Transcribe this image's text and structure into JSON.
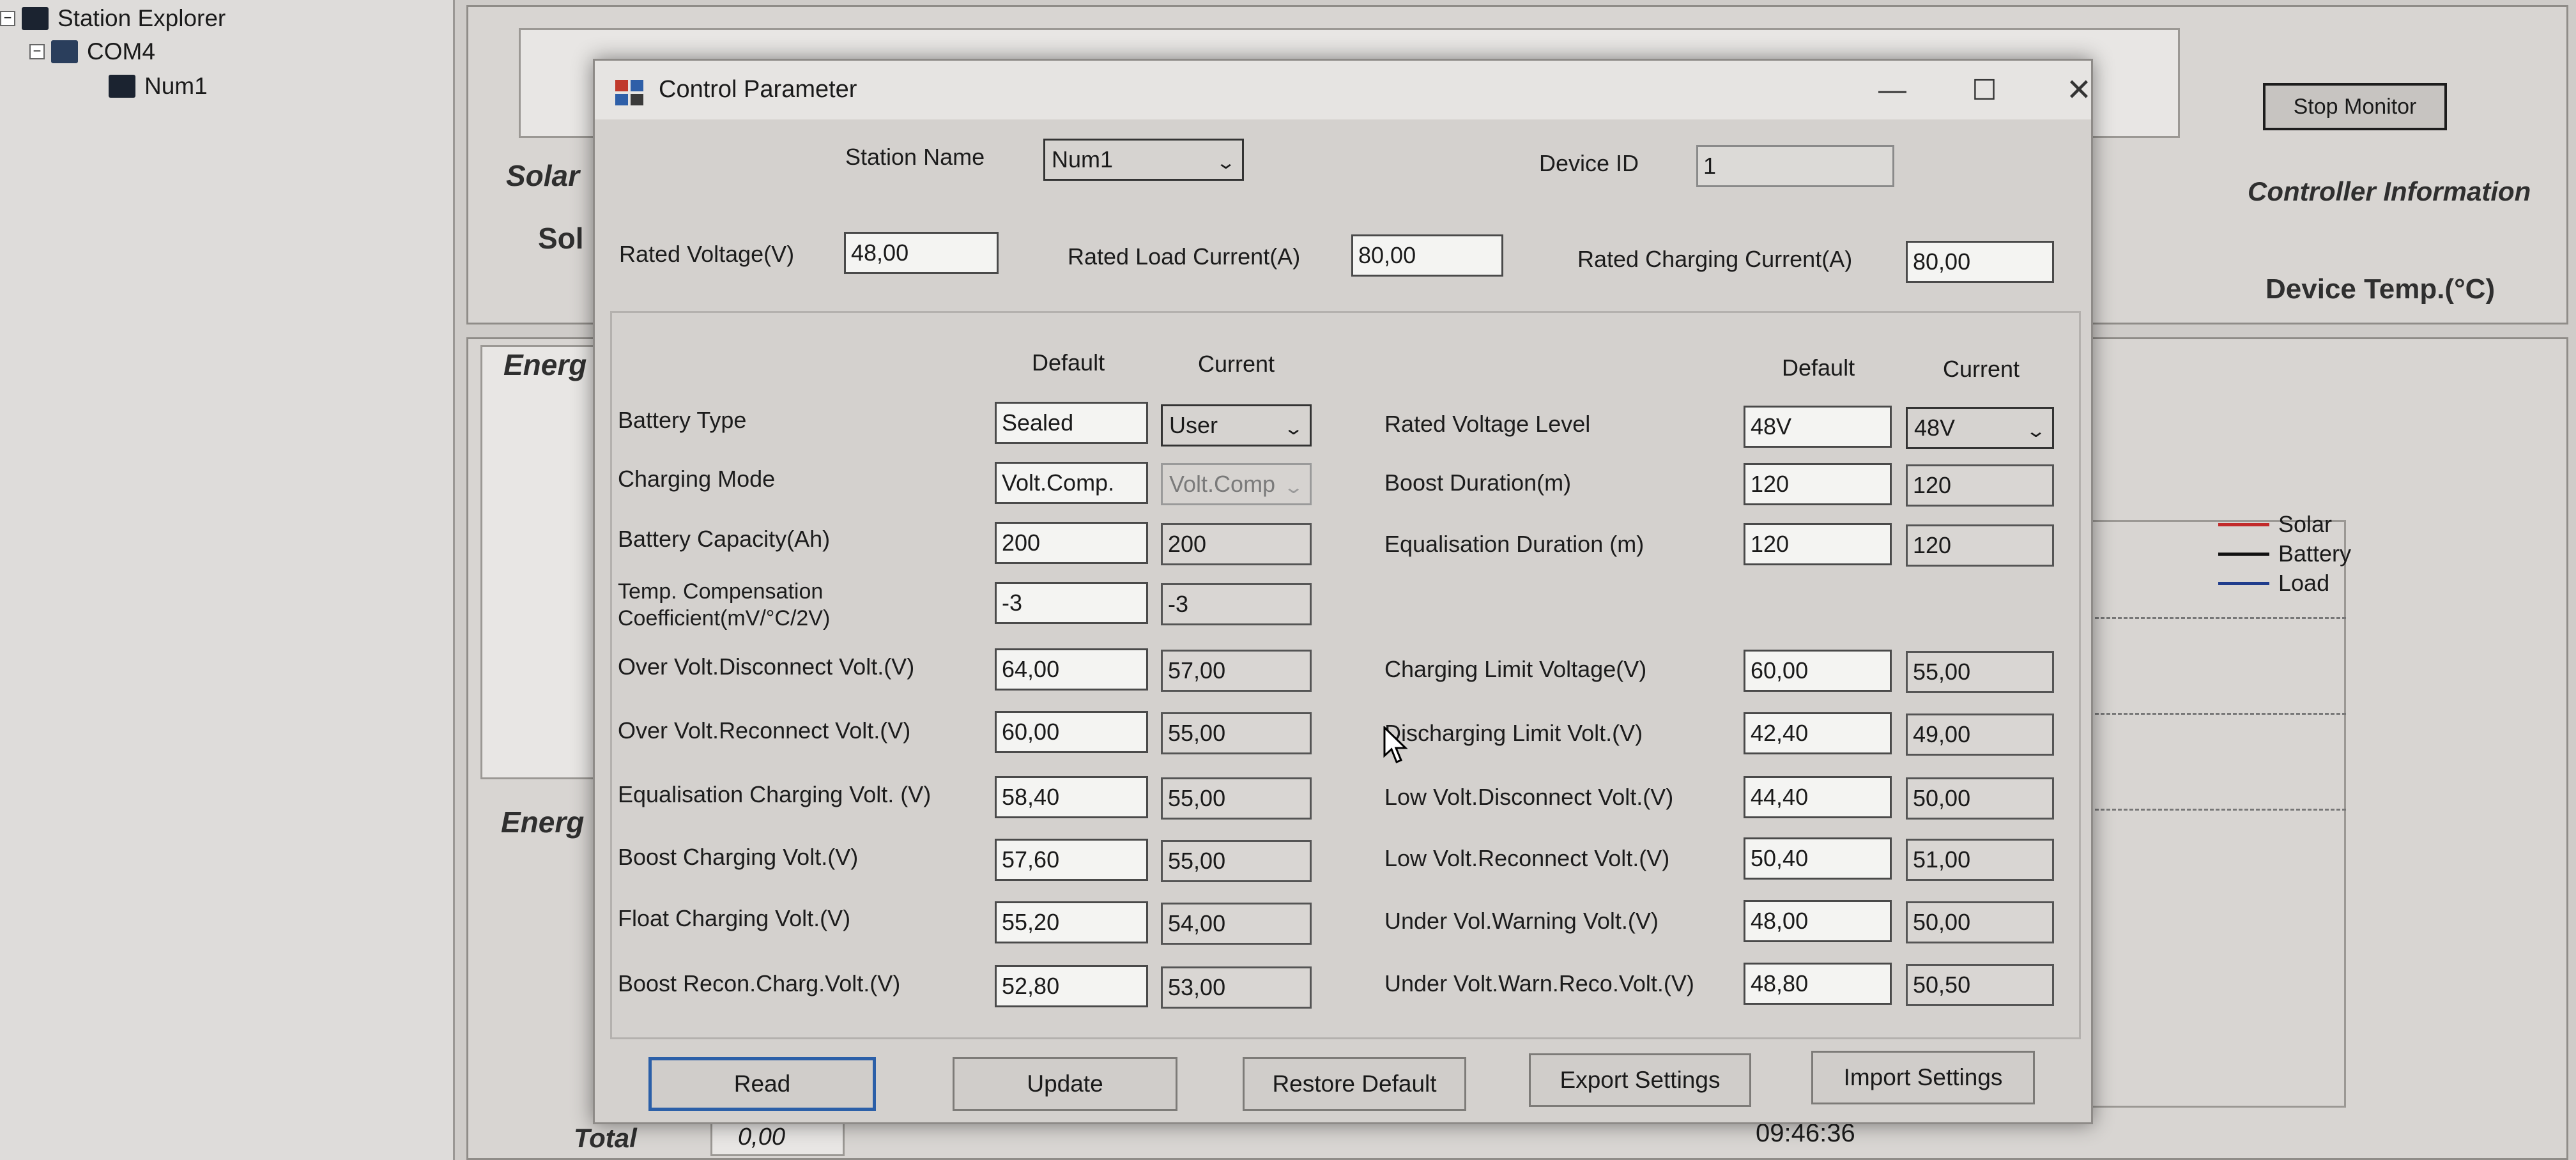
{
  "tree": {
    "root": "Station Explorer",
    "port": "COM4",
    "station": "Num1"
  },
  "background": {
    "stop_monitor": "Stop Monitor",
    "controller_info": "Controller Information",
    "device_temp": "Device Temp.(°C)",
    "labels": [
      "Solar",
      "Sol",
      "Energ",
      "Energ",
      "Total"
    ],
    "total_value": "0,00",
    "time": "09:46:36",
    "legend": [
      {
        "name": "Solar",
        "color": "#c22a2a"
      },
      {
        "name": "Battery",
        "color": "#111111"
      },
      {
        "name": "Load",
        "color": "#1f3c8c"
      }
    ]
  },
  "dialog": {
    "title": "Control Parameter",
    "window_buttons": {
      "minimize": "—",
      "maximize": "☐",
      "close": "✕"
    },
    "station_name_label": "Station Name",
    "station_name_value": "Num1",
    "device_id_label": "Device ID",
    "device_id_value": "1",
    "rated_voltage_label": "Rated Voltage(V)",
    "rated_voltage_value": "48,00",
    "rated_load_current_label": "Rated Load Current(A)",
    "rated_load_current_value": "80,00",
    "rated_charging_current_label": "Rated Charging Current(A)",
    "rated_charging_current_value": "80,00",
    "col_default": "Default",
    "col_current": "Current",
    "left_params": [
      {
        "label": "Battery Type",
        "default": "Sealed",
        "current": "User",
        "current_kind": "select"
      },
      {
        "label": "Charging Mode",
        "default": "Volt.Comp.",
        "current": "Volt.Comp",
        "current_kind": "select-disabled"
      },
      {
        "label": "Battery Capacity(Ah)",
        "default": "200",
        "current": "200"
      },
      {
        "label": "Temp. Compensation Coefficient(mV/°C/2V)",
        "default": "-3",
        "current": "-3"
      },
      {
        "label": "Over Volt.Disconnect Volt.(V)",
        "default": "64,00",
        "current": "57,00"
      },
      {
        "label": "Over Volt.Reconnect Volt.(V)",
        "default": "60,00",
        "current": "55,00"
      },
      {
        "label": "Equalisation Charging Volt. (V)",
        "default": "58,40",
        "current": "55,00"
      },
      {
        "label": "Boost Charging Volt.(V)",
        "default": "57,60",
        "current": "55,00"
      },
      {
        "label": "Float Charging Volt.(V)",
        "default": "55,20",
        "current": "54,00"
      },
      {
        "label": "Boost Recon.Charg.Volt.(V)",
        "default": "52,80",
        "current": "53,00"
      }
    ],
    "right_params": [
      {
        "label": "Rated Voltage Level",
        "default": "48V",
        "current": "48V",
        "current_kind": "select"
      },
      {
        "label": "Boost Duration(m)",
        "default": "120",
        "current": "120"
      },
      {
        "label": "Equalisation Duration (m)",
        "default": "120",
        "current": "120"
      },
      {
        "label": "Charging Limit Voltage(V)",
        "default": "60,00",
        "current": "55,00"
      },
      {
        "label": "Discharging Limit Volt.(V)",
        "default": "42,40",
        "current": "49,00"
      },
      {
        "label": "Low Volt.Disconnect Volt.(V)",
        "default": "44,40",
        "current": "50,00"
      },
      {
        "label": "Low Volt.Reconnect Volt.(V)",
        "default": "50,40",
        "current": "51,00"
      },
      {
        "label": "Under Vol.Warning Volt.(V)",
        "default": "48,00",
        "current": "50,00"
      },
      {
        "label": "Under Volt.Warn.Reco.Volt.(V)",
        "default": "48,80",
        "current": "50,50"
      }
    ],
    "buttons": {
      "read": "Read",
      "update": "Update",
      "restore_default": "Restore Default",
      "export_settings": "Export Settings",
      "import_settings": "Import Settings"
    }
  }
}
